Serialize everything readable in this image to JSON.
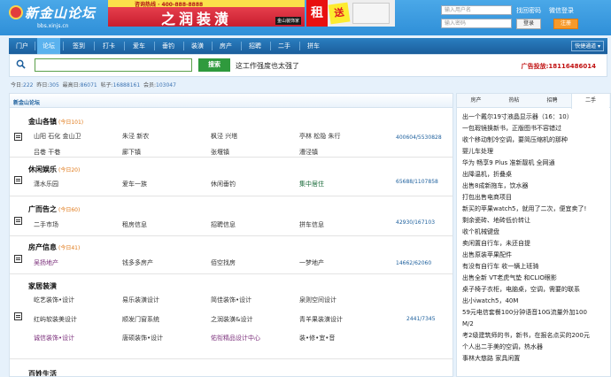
{
  "header": {
    "logo_text": "新金山论坛",
    "logo_url_text": "bbs.xinjs.cn",
    "banner_phone": "咨询热线 · 400-888-8888",
    "banner_main": "之润装潢",
    "banner_tag": "金山装饰家",
    "ad2_left": "租",
    "ad2_badge": "送",
    "username_placeholder": "输入用户名",
    "password_placeholder": "输入密码",
    "forgot_password": "找回密码",
    "wechat_login": "微信登录",
    "login_button": "登录",
    "register_button": "注册"
  },
  "nav": {
    "items": [
      "门户",
      "论坛",
      "签到",
      "打卡",
      "爱车",
      "垂钓",
      "装潢",
      "房产",
      "招聘",
      "二手",
      "拼车"
    ],
    "active_index": 1,
    "quick_nav": "快捷通道"
  },
  "search": {
    "input_value": "",
    "button_label": "搜索",
    "slogan": "这工作强度也太强了",
    "ad_contact": "广告投放:18116486014"
  },
  "stats": {
    "today_label": "今日:",
    "today": "222",
    "yesterday_label": "昨日:",
    "yesterday": "305",
    "max_label": "最高日:",
    "max": "86071",
    "posts_label": "帖子:",
    "posts": "16888161",
    "members_label": "会员:",
    "members": "103047"
  },
  "forum": {
    "section_title": "新金山论坛",
    "categories": [
      {
        "name": "金山各镇",
        "today": "(今日101)",
        "count": "400604/5530828",
        "rows": [
          [
            "山阳 石化 金山卫",
            "朱泾 新农",
            "枫泾 兴塔",
            "亭林 松隐 朱行"
          ],
          [
            "吕巷 干巷",
            "廊下镇",
            "张堰镇",
            "漕泾镇"
          ]
        ]
      },
      {
        "name": "休闲娱乐",
        "today": "(今日20)",
        "count": "65688/1107858",
        "rows": [
          [
            "潇水乐园",
            "爱车一族",
            "休闲垂钓",
            "集中居住"
          ]
        ]
      },
      {
        "name": "广而告之",
        "today": "(今日60)",
        "count": "42930/167103",
        "rows": [
          [
            "二手市场",
            "租房信息",
            "招聘信息",
            "拼车信息"
          ]
        ]
      },
      {
        "name": "房产信息",
        "today": "(今日41)",
        "count": "14662/62060",
        "rows": [
          [
            "吴扬地产",
            "钱多多房产",
            "佰空找房",
            "一梦地产"
          ]
        ]
      },
      {
        "name": "家居装潢",
        "today": "",
        "count": "2441/7345",
        "rows": [
          [
            "屹艺装饰•设计",
            "易乐装潢设计",
            "简佳装饰•设计",
            "泉则空间设计"
          ],
          [
            "红屿软装美设计",
            "顺发门窗系统",
            "之润装潢&设计",
            "青羊果装潢设计"
          ],
          [
            "诚信装饰•设计",
            "唐硕装饰•设计",
            "佑衔精品设计中心",
            "装•修•宜•音"
          ]
        ]
      },
      {
        "name": "百姓生活",
        "today": "",
        "count": "",
        "rows": []
      }
    ]
  },
  "side": {
    "tabs": [
      "房产",
      "热帖",
      "招聘",
      "二手"
    ],
    "active_index": 3,
    "items": [
      "出一个戴尔19寸液晶显示器（16：10）",
      "一包瑕镜换新书，正版图书不容错过",
      "收个移动制冷空调，要简压缩机的那种",
      "婴儿车处理",
      "华为 畅享9 Plus 准新靓机 全网通",
      "出降温机，折叠桌",
      "出售8成新拖车，饮水器",
      "打包出售电商项目",
      "新买的苹果watch5，就用了二次，便宜卖了!",
      "剩余瓷砖、地砖低价转让",
      "收个机械键盘",
      "卖闲置自行车，未还自提",
      "出售原装苹果配件",
      "有没有自行车 收一辆上班骑",
      "出售全新 VT老虎气垫 和CLIO眼影",
      "桌子椅子衣柜，电脑桌，空调，需要的联系",
      "出小iwatch5，40M",
      "59元电信套餐100分钟语音10G流量外加100",
      "M/2",
      "考2级建筑师的书，新书，在报名点买的200元",
      "个人出二手美的空调，热水器",
      "事林大慈路 家具闲置"
    ]
  }
}
